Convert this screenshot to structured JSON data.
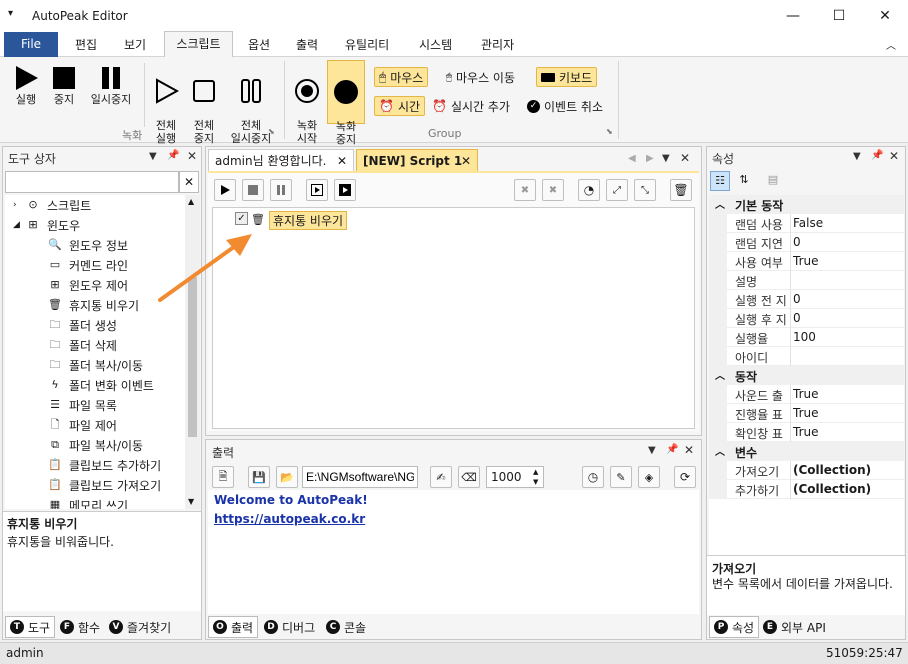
{
  "window": {
    "title": "AutoPeak Editor",
    "minimize": "—",
    "maximize": "☐",
    "close": "✕"
  },
  "menu": {
    "file": "File",
    "items": [
      "편집",
      "보기",
      "스크립트",
      "옵션",
      "출력",
      "유틸리티",
      "시스템",
      "관리자"
    ]
  },
  "ribbon": {
    "rec_group": "녹화",
    "group2": "Group",
    "run": "실행",
    "stop": "중지",
    "pause": "일시중지",
    "run_all": "전체\n실행",
    "stop_all": "전체\n중지",
    "pause_all": "전체\n일시중지",
    "rec_start": "녹화\n시작",
    "rec_stop": "녹화\n중지",
    "mouse": "마우스",
    "mouse_move": "마우스 이동",
    "keyboard": "키보드",
    "time": "시간",
    "add_realtime": "실시간 추가",
    "cancel_event": "이벤트 취소"
  },
  "toolbox": {
    "title": "도구 상자",
    "search_placeholder": "",
    "clear": "✕",
    "items": [
      {
        "label": "스크립트",
        "level": 0,
        "expand": "›"
      },
      {
        "label": "윈도우",
        "level": 0,
        "expand": "◢"
      },
      {
        "label": "윈도우 정보",
        "level": 1,
        "icon": "magnifier-icon"
      },
      {
        "label": "커멘드 라인",
        "level": 1,
        "icon": "cmd-icon"
      },
      {
        "label": "윈도우 제어",
        "level": 1,
        "icon": "windows-icon"
      },
      {
        "label": "휴지통 비우기",
        "level": 1,
        "icon": "trash-icon"
      },
      {
        "label": "폴더 생성",
        "level": 1,
        "icon": "folder-add-icon"
      },
      {
        "label": "폴더 삭제",
        "level": 1,
        "icon": "folder-delete-icon"
      },
      {
        "label": "폴더 복사/이동",
        "level": 1,
        "icon": "folder-copy-icon"
      },
      {
        "label": "폴더 변화 이벤트",
        "level": 1,
        "icon": "lightning-icon"
      },
      {
        "label": "파일 목록",
        "level": 1,
        "icon": "list-icon"
      },
      {
        "label": "파일 제어",
        "level": 1,
        "icon": "file-icon"
      },
      {
        "label": "파일 복사/이동",
        "level": 1,
        "icon": "file-copy-icon"
      },
      {
        "label": "클립보드 추가하기",
        "level": 1,
        "icon": "clipboard-icon"
      },
      {
        "label": "클립보드 가져오기",
        "level": 1,
        "icon": "clipboard-get-icon"
      },
      {
        "label": "메모리 쓰기",
        "level": 1,
        "icon": "memory-icon"
      }
    ],
    "desc_title": "휴지통 비우기",
    "desc_text": "휴지통을 비워줍니다.",
    "tabs": [
      {
        "key": "T",
        "label": "도구"
      },
      {
        "key": "F",
        "label": "함수"
      },
      {
        "key": "V",
        "label": "즐겨찾기"
      }
    ]
  },
  "doc": {
    "tabs": [
      "admin님 환영합니다.",
      "[NEW] Script 1"
    ],
    "node_label": "휴지통 비우기"
  },
  "output": {
    "title": "출력",
    "path": "E:\\NGMsoftware\\NG",
    "speed": "1000",
    "lines": [
      "Welcome to AutoPeak!",
      "https://autopeak.co.kr"
    ],
    "tabs": [
      {
        "key": "O",
        "label": "출력"
      },
      {
        "key": "D",
        "label": "디버그"
      },
      {
        "key": "C",
        "label": "콘솔"
      }
    ]
  },
  "props": {
    "title": "속성",
    "cat1": "기본 동작",
    "rows1": [
      [
        "랜덤 사용",
        "False"
      ],
      [
        "랜덤 지연",
        "0"
      ],
      [
        "사용 여부",
        "True"
      ],
      [
        "설명",
        ""
      ],
      [
        "실행 전 지",
        "0"
      ],
      [
        "실행 후 지",
        "0"
      ],
      [
        "실행율",
        "100"
      ],
      [
        "아이디",
        ""
      ]
    ],
    "cat2": "동작",
    "rows2": [
      [
        "사운드 출",
        "True"
      ],
      [
        "진행율 표",
        "True"
      ],
      [
        "확인창 표",
        "True"
      ]
    ],
    "cat3": "변수",
    "rows3": [
      [
        "가져오기",
        "(Collection)"
      ],
      [
        "추가하기",
        "(Collection)"
      ]
    ],
    "desc_title": "가져오기",
    "desc_text": "변수 목록에서 데이터를 가져옵니다.",
    "tabs": [
      {
        "key": "P",
        "label": "속성"
      },
      {
        "key": "E",
        "label": "외부 API"
      }
    ]
  },
  "status": {
    "user": "admin",
    "time": "51059:25:47"
  }
}
